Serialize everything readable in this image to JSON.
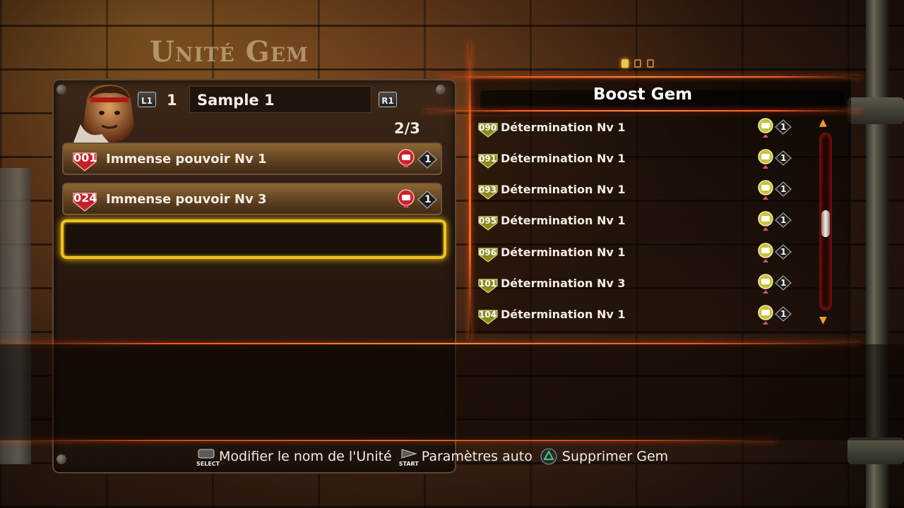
{
  "screen": {
    "title": "Unité Gem"
  },
  "page_indicator": {
    "pages": 3,
    "current": 1
  },
  "unit": {
    "prev_button": "L1",
    "next_button": "R1",
    "number": "1",
    "name": "Sample 1",
    "count": "2/3",
    "slots": [
      {
        "number": "001",
        "name": "Immense pouvoir Nv 1",
        "cost": "1",
        "badge_color": "#c4202a"
      },
      {
        "number": "024",
        "name": "Immense pouvoir Nv 3",
        "cost": "1",
        "badge_color": "#c4202a"
      }
    ]
  },
  "gem_list": {
    "title": "Boost Gem",
    "items": [
      {
        "number": "090",
        "name": "Détermination Nv 1",
        "cost": "1"
      },
      {
        "number": "091",
        "name": "Détermination Nv 1",
        "cost": "1"
      },
      {
        "number": "093",
        "name": "Détermination Nv 1",
        "cost": "1"
      },
      {
        "number": "095",
        "name": "Détermination Nv 1",
        "cost": "1"
      },
      {
        "number": "096",
        "name": "Détermination Nv 1",
        "cost": "1"
      },
      {
        "number": "101",
        "name": "Détermination Nv 3",
        "cost": "1"
      },
      {
        "number": "104",
        "name": "Détermination Nv 1",
        "cost": "1"
      }
    ],
    "badge_color": "#8a8a1e",
    "scroll_position": 0.5
  },
  "footer": {
    "hints": [
      {
        "button": "SELECT",
        "icon": "select-button-icon",
        "label": "Modifier le nom de l'Unité"
      },
      {
        "button": "START",
        "icon": "start-button-icon",
        "label": "Paramètres auto"
      },
      {
        "button": "",
        "icon": "triangle-button-icon",
        "label": "Supprimer Gem"
      }
    ]
  },
  "colors": {
    "accent": "#ff5a1a",
    "selection": "#f1c21d",
    "power_gem": "#c4202a",
    "boost_gem": "#c6c23a"
  }
}
